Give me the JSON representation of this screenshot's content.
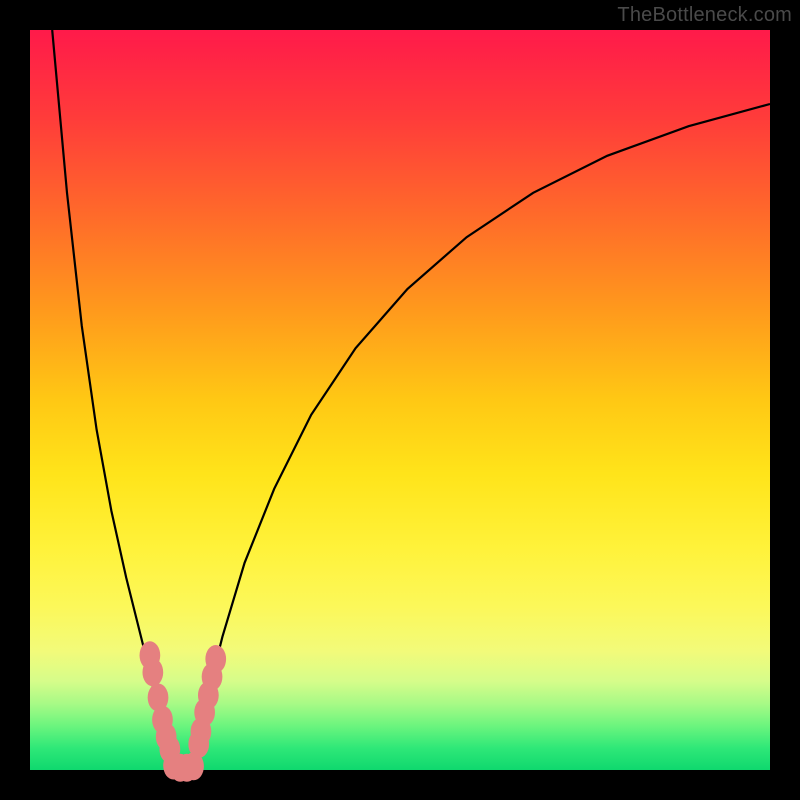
{
  "watermark": "TheBottleneck.com",
  "chart_data": {
    "type": "line",
    "title": "",
    "xlabel": "",
    "ylabel": "",
    "xlim": [
      0,
      100
    ],
    "ylim": [
      0,
      100
    ],
    "gradient_stops": [
      {
        "pos": 0,
        "color": "#ff1a4a"
      },
      {
        "pos": 25,
        "color": "#ff6a2a"
      },
      {
        "pos": 50,
        "color": "#ffc814"
      },
      {
        "pos": 70,
        "color": "#fff23a"
      },
      {
        "pos": 88,
        "color": "#d6fc8a"
      },
      {
        "pos": 100,
        "color": "#0fd86e"
      }
    ],
    "series": [
      {
        "name": "left-curve",
        "x": [
          3.0,
          5.0,
          7.0,
          9.0,
          11.0,
          13.0,
          14.5,
          16.0,
          17.0,
          18.0,
          18.7,
          19.2,
          19.6,
          20.0
        ],
        "y": [
          100.0,
          78.0,
          60.0,
          46.0,
          35.0,
          26.0,
          20.0,
          14.0,
          9.5,
          6.0,
          3.5,
          2.0,
          1.0,
          0.0
        ]
      },
      {
        "name": "right-curve",
        "x": [
          21.5,
          22.5,
          24.0,
          26.0,
          29.0,
          33.0,
          38.0,
          44.0,
          51.0,
          59.0,
          68.0,
          78.0,
          89.0,
          100.0
        ],
        "y": [
          0.0,
          4.0,
          10.0,
          18.0,
          28.0,
          38.0,
          48.0,
          57.0,
          65.0,
          72.0,
          78.0,
          83.0,
          87.0,
          90.0
        ]
      }
    ],
    "markers": [
      {
        "name": "left-cluster",
        "x": 16.2,
        "y": 15.5
      },
      {
        "name": "left-cluster",
        "x": 16.6,
        "y": 13.2
      },
      {
        "name": "left-cluster",
        "x": 17.3,
        "y": 9.8
      },
      {
        "name": "left-cluster",
        "x": 17.9,
        "y": 6.8
      },
      {
        "name": "left-cluster",
        "x": 18.4,
        "y": 4.5
      },
      {
        "name": "left-cluster",
        "x": 18.9,
        "y": 2.8
      },
      {
        "name": "bottom",
        "x": 19.4,
        "y": 0.6
      },
      {
        "name": "bottom",
        "x": 20.3,
        "y": 0.3
      },
      {
        "name": "bottom",
        "x": 21.2,
        "y": 0.3
      },
      {
        "name": "bottom",
        "x": 22.1,
        "y": 0.5
      },
      {
        "name": "right-cluster",
        "x": 22.8,
        "y": 3.5
      },
      {
        "name": "right-cluster",
        "x": 23.1,
        "y": 5.2
      },
      {
        "name": "right-cluster",
        "x": 23.6,
        "y": 7.8
      },
      {
        "name": "right-cluster",
        "x": 24.1,
        "y": 10.1
      },
      {
        "name": "right-cluster",
        "x": 24.6,
        "y": 12.6
      },
      {
        "name": "right-cluster",
        "x": 25.1,
        "y": 15.0
      }
    ],
    "marker_color": "#e58080",
    "marker_radius": 1.4
  }
}
